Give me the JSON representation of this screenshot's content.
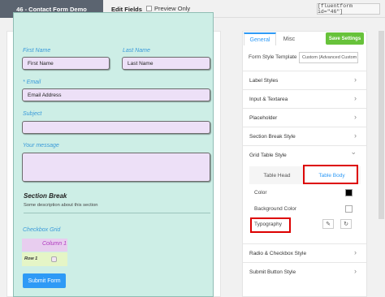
{
  "topbar": {
    "form_title": "46 - Contact Form Demo",
    "edit_fields": "Edit Fields",
    "preview_label": "Preview Only",
    "shortcode": "[fluentform id=\"46\"]"
  },
  "form": {
    "first_name_label": "First Name",
    "first_name_placeholder": "First Name",
    "last_name_label": "Last Name",
    "last_name_placeholder": "Last Name",
    "email_label": "* Email",
    "email_placeholder": "Email Address",
    "subject_label": "Subject",
    "message_label": "Your message",
    "section_title": "Section Break",
    "section_desc": "Some description about this section",
    "grid_label": "Checkbox Grid",
    "grid_column": "Column 1",
    "grid_row": "Row 1",
    "submit_label": "Submit Form"
  },
  "panel": {
    "tab_general": "General",
    "tab_misc": "Misc",
    "save_label": "Save Settings",
    "style_template_label": "Form Style Template",
    "style_template_value": "Custom (Advanced Custom",
    "accordion": [
      "Label Styles",
      "Input & Textarea",
      "Placeholder",
      "Section Break Style",
      "Grid Table Style",
      "Radio & Checkbox Style",
      "Submit Button Style"
    ],
    "sub_tabs": [
      "Table Head",
      "Table Body"
    ],
    "settings": {
      "color": "Color",
      "background_color": "Background Color",
      "typography": "Typography"
    },
    "chevron_glyph": "›",
    "chevron_down_glyph": "⌄",
    "edit_glyph": "✎",
    "reset_glyph": "↻"
  },
  "colors": {
    "accent": "#2e9af6",
    "save_green": "#67c23a",
    "highlight_red": "#d00000",
    "form_bg": "#cdeee6",
    "field_bg": "#ede0f7"
  }
}
